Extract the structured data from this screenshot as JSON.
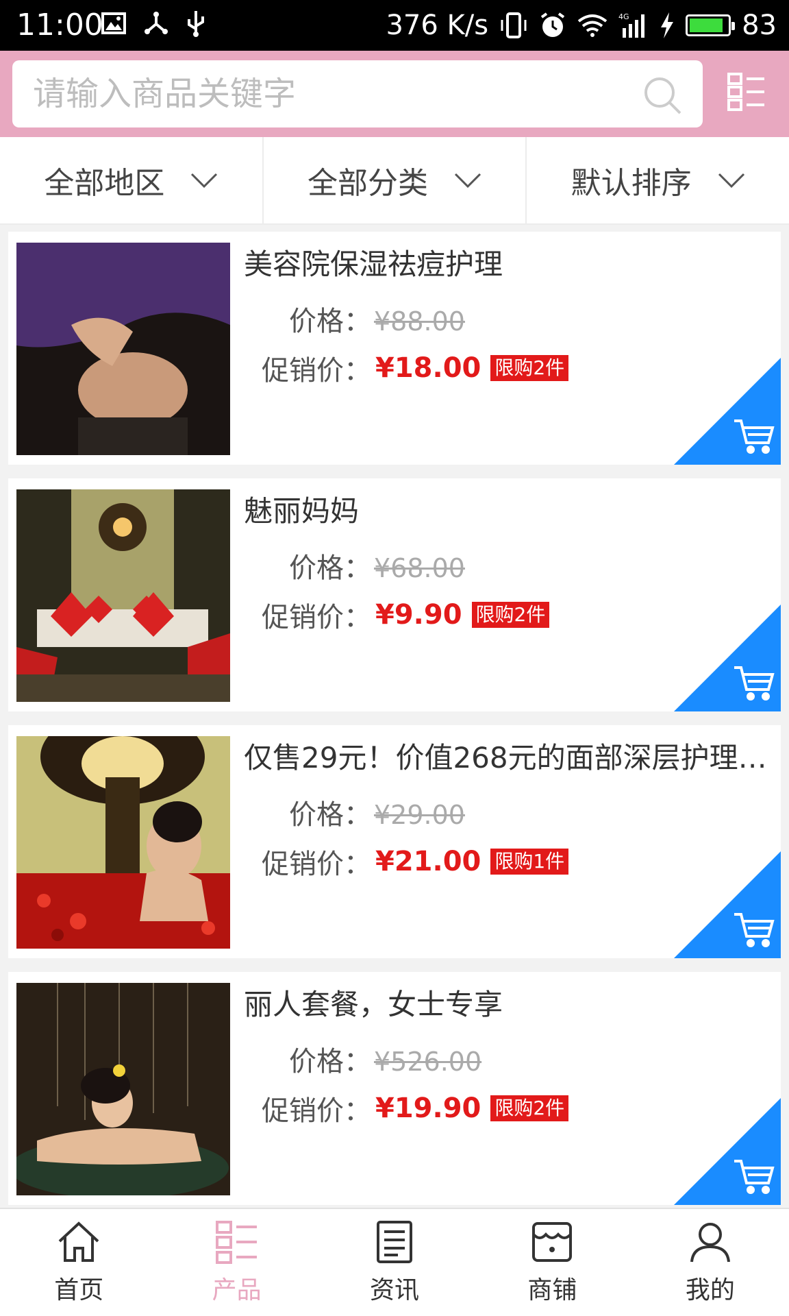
{
  "status_bar": {
    "time": "11:00",
    "network_speed": "376 K/s",
    "network_type": "4G",
    "battery": "83",
    "battery_level_percent": 83,
    "icons": [
      "image-icon",
      "usb-share-icon",
      "usb-icon",
      "vibrate-icon",
      "alarm-icon",
      "wifi-icon",
      "signal-icon",
      "charging-icon",
      "battery-icon"
    ]
  },
  "search": {
    "placeholder": "请输入商品关键字"
  },
  "filters": [
    {
      "label": "全部地区"
    },
    {
      "label": "全部分类"
    },
    {
      "label": "默认排序"
    }
  ],
  "labels": {
    "price": "价格：",
    "promo": "促销价："
  },
  "products": [
    {
      "title": "美容院保湿祛痘护理",
      "price": "¥88.00",
      "promo_price": "¥18.00",
      "limit": "限购2件"
    },
    {
      "title": "魅丽妈妈",
      "price": "¥68.00",
      "promo_price": "¥9.90",
      "limit": "限购2件"
    },
    {
      "title": "仅售29元！价值268元的面部深层护理…",
      "price": "¥29.00",
      "promo_price": "¥21.00",
      "limit": "限购1件"
    },
    {
      "title": "丽人套餐，女士专享",
      "price": "¥526.00",
      "promo_price": "¥19.90",
      "limit": "限购2件"
    }
  ],
  "nav": [
    {
      "label": "首页",
      "icon": "home-icon"
    },
    {
      "label": "产品",
      "icon": "grid-list-icon",
      "active": true
    },
    {
      "label": "资讯",
      "icon": "news-icon"
    },
    {
      "label": "商铺",
      "icon": "shop-icon"
    },
    {
      "label": "我的",
      "icon": "user-icon"
    }
  ],
  "colors": {
    "header_pink": "#e8a8c0",
    "promo_red": "#e21a1a",
    "cart_blue": "#1a8cff",
    "nav_active": "#e8a8c0"
  }
}
